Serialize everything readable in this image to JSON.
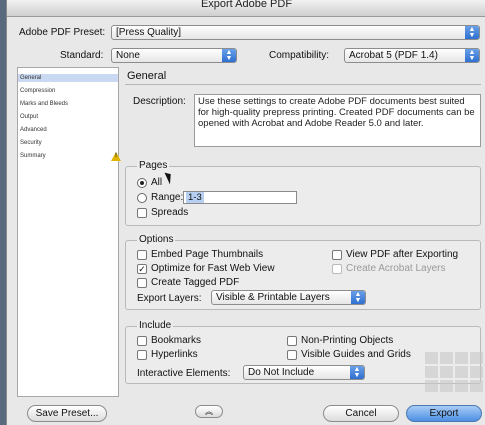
{
  "window": {
    "title": "Export Adobe PDF"
  },
  "preset": {
    "label": "Adobe PDF Preset:",
    "value": "[Press Quality]"
  },
  "standard": {
    "label": "Standard:",
    "value": "None"
  },
  "compatibility": {
    "label": "Compatibility:",
    "value": "Acrobat 5 (PDF 1.4)"
  },
  "sidebar": {
    "items": [
      {
        "label": "General",
        "selected": true
      },
      {
        "label": "Compression"
      },
      {
        "label": "Marks and Bleeds"
      },
      {
        "label": "Output"
      },
      {
        "label": "Advanced"
      },
      {
        "label": "Security"
      },
      {
        "label": "Summary"
      }
    ]
  },
  "general": {
    "heading": "General",
    "description_label": "Description:",
    "description_text": "Use these settings to create Adobe PDF documents best suited for high-quality prepress printing.  Created PDF documents can be opened with Acrobat and Adobe Reader 5.0 and later."
  },
  "pages": {
    "heading": "Pages",
    "all_label": "All",
    "range_label": "Range:",
    "range_value": "1-3",
    "spreads_label": "Spreads"
  },
  "options": {
    "heading": "Options",
    "embed_thumbnails": "Embed Page Thumbnails",
    "optimize_web": "Optimize for Fast Web View",
    "tagged_pdf": "Create Tagged PDF",
    "view_after": "View PDF after Exporting",
    "acrobat_layers": "Create Acrobat Layers",
    "export_layers_label": "Export Layers:",
    "export_layers_value": "Visible & Printable Layers"
  },
  "include": {
    "heading": "Include",
    "bookmarks": "Bookmarks",
    "hyperlinks": "Hyperlinks",
    "non_printing": "Non-Printing Objects",
    "visible_guides": "Visible Guides and Grids",
    "interactive_label": "Interactive Elements:",
    "interactive_value": "Do Not Include"
  },
  "buttons": {
    "save_preset": "Save Preset...",
    "cancel": "Cancel",
    "export": "Export"
  }
}
